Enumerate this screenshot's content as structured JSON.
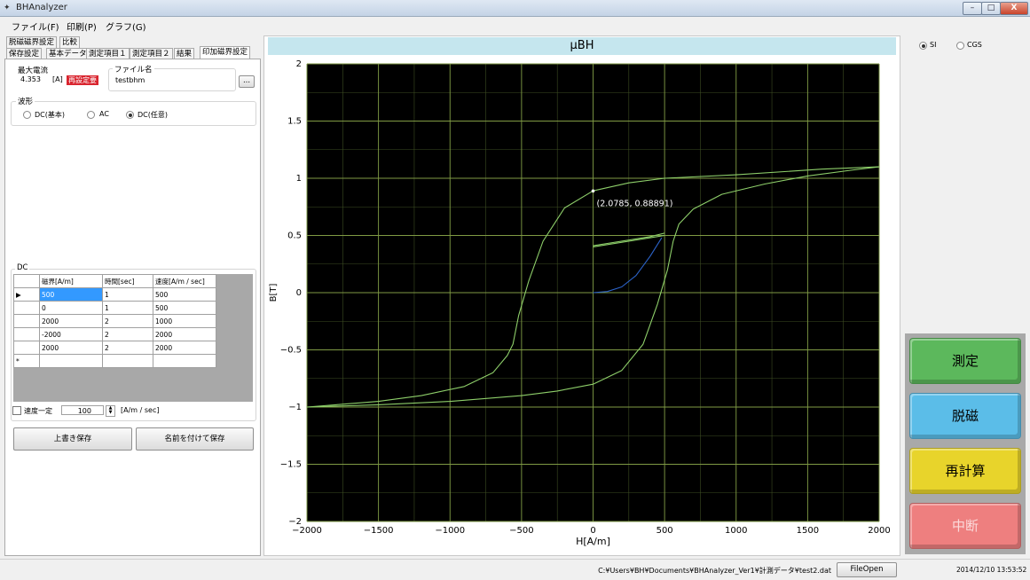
{
  "window": {
    "title": "BHAnalyzer",
    "minimize": "–",
    "maximize": "□",
    "close": "X"
  },
  "menu": {
    "file": "ファイル(F)",
    "print": "印刷(P)",
    "graph": "グラフ(G)"
  },
  "tabs_row1": [
    "脱磁磁界設定",
    "比較"
  ],
  "tabs_row2": [
    "保存設定",
    "基本データ",
    "測定項目１",
    "測定項目２",
    "結果",
    "印加磁界設定"
  ],
  "left": {
    "max_current_label": "最大電流",
    "max_current_value": "4.353",
    "max_current_unit": "[A]",
    "max_current_badge": "再設定要",
    "file_name_label": "ファイル名",
    "file_name_value": "testbhm",
    "browse_label": "...",
    "waveform_label": "波形",
    "waveform_options": [
      "DC(基本)",
      "AC",
      "DC(任意)"
    ],
    "waveform_selected": "DC(任意)",
    "dc_label": "DC",
    "dc_headers": [
      "磁界[A/m]",
      "時間[sec]",
      "速度[A/m / sec]"
    ],
    "dc_rows": [
      [
        "500",
        "1",
        "500"
      ],
      [
        "0",
        "1",
        "500"
      ],
      [
        "2000",
        "2",
        "1000"
      ],
      [
        "-2000",
        "2",
        "2000"
      ],
      [
        "2000",
        "2",
        "2000"
      ]
    ],
    "row_marker": "▶",
    "new_row_marker": "*",
    "speed_const_label": "速度一定",
    "speed_const_checked": false,
    "speed_value": "100",
    "speed_unit": "[A/m / sec]",
    "overwrite_save": "上書き保存",
    "save_as": "名前を付けて保存"
  },
  "chart_title": "μBH",
  "chart_data": {
    "type": "line",
    "title": "μBH",
    "xlabel": "H[A/m]",
    "ylabel": "B[T]",
    "xlim": [
      -2000,
      2000
    ],
    "ylim": [
      -2,
      2
    ],
    "xticks": [
      "-2000",
      "-1500",
      "-1000",
      "-500",
      "0",
      "500",
      "1000",
      "1500",
      "2000"
    ],
    "yticks": [
      "2",
      "1.5",
      "1",
      "0.5",
      "0",
      "-0.5",
      "-1",
      "-1.5",
      "-2"
    ],
    "grid": true,
    "background": "#000000",
    "annotation": {
      "text": "(2.0785, 0.88891)",
      "x": 0,
      "y": 0.889
    },
    "series": [
      {
        "color": "#8ecf6a",
        "x": [
          2000,
          1600,
          1000,
          500,
          250,
          0,
          -200,
          -350,
          -450,
          -520,
          -560,
          -600,
          -700,
          -900,
          -1200,
          -1500,
          -1800,
          -2000
        ],
        "y": [
          1.1,
          1.08,
          1.03,
          1.0,
          0.96,
          0.89,
          0.74,
          0.45,
          0.1,
          -0.2,
          -0.45,
          -0.55,
          -0.7,
          -0.82,
          -0.9,
          -0.95,
          -0.98,
          -1.0
        ]
      },
      {
        "color": "#8ecf6a",
        "x": [
          -2000,
          -1500,
          -1000,
          -500,
          -250,
          0,
          200,
          350,
          450,
          520,
          560,
          600,
          700,
          900,
          1200,
          1500,
          1800,
          2000
        ],
        "y": [
          -1.0,
          -0.98,
          -0.95,
          -0.9,
          -0.86,
          -0.8,
          -0.68,
          -0.45,
          -0.1,
          0.2,
          0.45,
          0.6,
          0.73,
          0.86,
          0.95,
          1.02,
          1.07,
          1.1
        ]
      },
      {
        "color": "#8ecf6a",
        "x": [
          0,
          100,
          250,
          400,
          500
        ],
        "y": [
          0.4,
          0.42,
          0.45,
          0.48,
          0.5
        ]
      },
      {
        "color": "#8ecf6a",
        "x": [
          500,
          400,
          250,
          100,
          0
        ],
        "y": [
          0.52,
          0.49,
          0.46,
          0.43,
          0.41
        ]
      },
      {
        "color": "#2c63c9",
        "x": [
          0,
          100,
          200,
          300,
          400,
          480
        ],
        "y": [
          0,
          0.01,
          0.05,
          0.15,
          0.32,
          0.48
        ]
      }
    ]
  },
  "units": {
    "si": "SI",
    "cgs": "CGS",
    "selected": "SI"
  },
  "actions": {
    "measure": "測定",
    "measure_color": "#5cb85c",
    "demag": "脱磁",
    "demag_color": "#5bbde8",
    "recalc": "再計算",
    "recalc_color": "#e8d42b",
    "stop": "中断",
    "stop_color": "#ee7f7f"
  },
  "status": {
    "path": "C:¥Users¥BH¥Documents¥BHAnalyzer_Ver1¥計測データ¥test2.dat",
    "file_open": "FileOpen",
    "datetime": "2014/12/10 13:53:52"
  }
}
